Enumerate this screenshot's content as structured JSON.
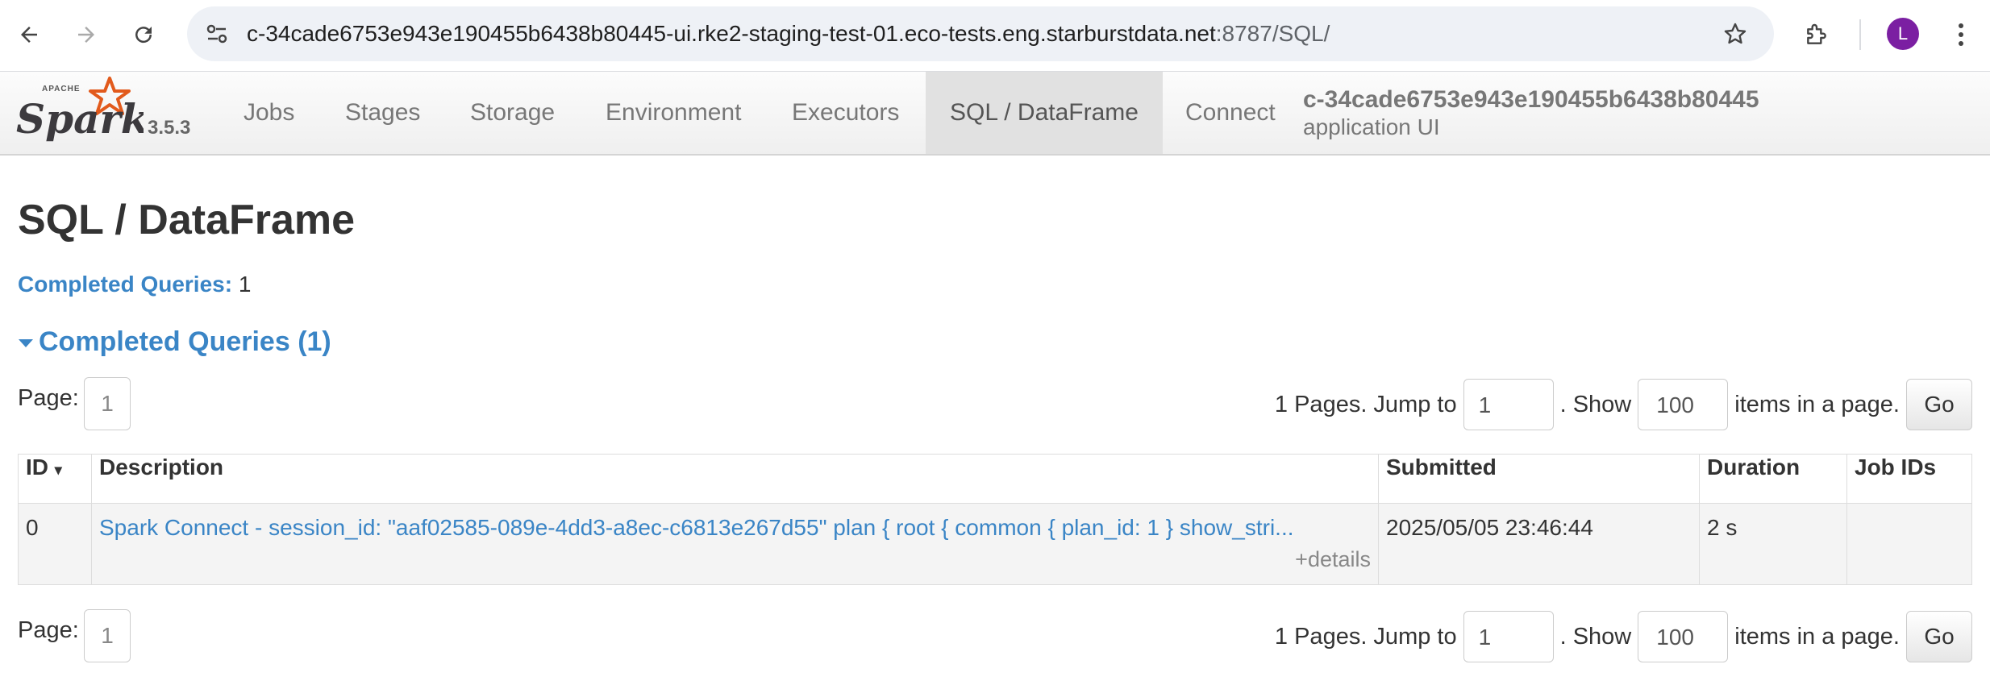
{
  "browser": {
    "url_host": "c-34cade6753e943e190455b6438b80445-ui.rke2-staging-test-01.eco-tests.eng.starburstdata.net",
    "url_path": ":8787/SQL/",
    "profile_initial": "L"
  },
  "navbar": {
    "brand": "Spark",
    "version": "3.5.3",
    "tabs": [
      {
        "label": "Jobs"
      },
      {
        "label": "Stages"
      },
      {
        "label": "Storage"
      },
      {
        "label": "Environment"
      },
      {
        "label": "Executors"
      },
      {
        "label": "SQL / DataFrame",
        "active": true
      },
      {
        "label": "Connect"
      }
    ],
    "app_id": "c-34cade6753e943e190455b6438b80445",
    "app_suffix": "application UI"
  },
  "page": {
    "title": "SQL / DataFrame",
    "summary_label": "Completed Queries:",
    "summary_value": "1",
    "section_title": "Completed Queries (1)"
  },
  "pagination": {
    "page_label": "Page:",
    "current_page": "1",
    "pages_text": "1 Pages. Jump to",
    "jump_value": "1",
    "show_text": ". Show",
    "show_value": "100",
    "items_text": "items in a page.",
    "go_label": "Go"
  },
  "table": {
    "headers": [
      "ID",
      "Description",
      "Submitted",
      "Duration",
      "Job IDs"
    ],
    "sort_indicator": "▾",
    "rows": [
      {
        "id": "0",
        "description": "Spark Connect - session_id: \"aaf02585-089e-4dd3-a8ec-c6813e267d55\" plan { root { common { plan_id: 1 } show_stri...",
        "details": "+details",
        "submitted": "2025/05/05 23:46:44",
        "duration": "2 s",
        "job_ids": ""
      }
    ]
  },
  "colors": {
    "link": "#3a85c6",
    "spark_orange": "#e25a1c",
    "avatar": "#7b1fa2"
  }
}
